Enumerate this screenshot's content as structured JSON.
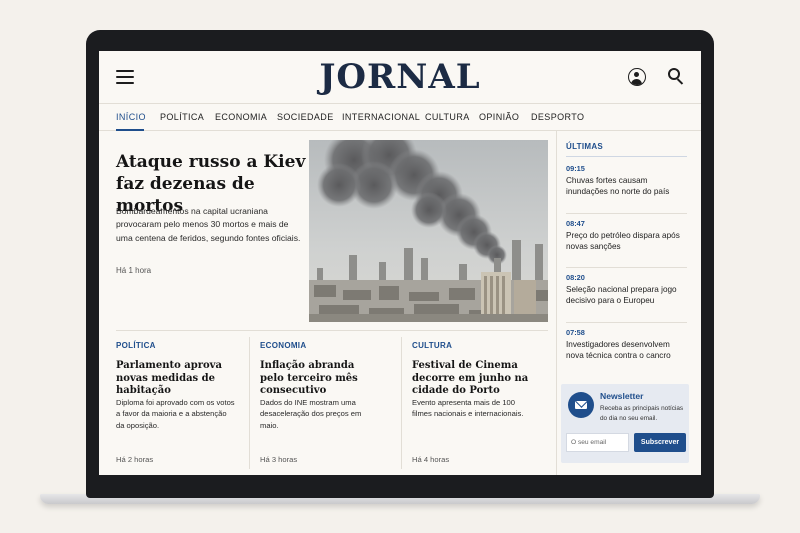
{
  "header": {
    "logo": "JORNAL",
    "menu_icon": "hamburger-icon",
    "account_icon": "user-icon",
    "search_icon": "search-icon"
  },
  "nav": {
    "items": [
      "INÍCIO",
      "POLÍTICA",
      "ECONOMIA",
      "SOCIEDADE",
      "INTERNACIONAL",
      "CULTURA",
      "OPINIÃO",
      "DESPORTO"
    ],
    "active": "INÍCIO"
  },
  "hero": {
    "title": "Ataque russo a Kiev faz dezenas de mortos",
    "summary": "Bombardeamentos na capital ucraniana provocaram pelo menos 30 mortos e mais de uma centena de feridos, segundo fontes oficiais.",
    "time": "Há 1 hora"
  },
  "articles": [
    {
      "category": "POLÍTICA",
      "title": "Parlamento aprova novas medidas de habitação",
      "summary": "Diploma foi aprovado com os votos a favor da maioria e a abstenção da oposição.",
      "time": "Há 2 horas"
    },
    {
      "category": "ECONOMIA",
      "title": "Inflação abranda pelo terceiro mês consecutivo",
      "summary": "Dados do INE mostram uma desaceleração dos preços em maio.",
      "time": "Há 3 horas"
    },
    {
      "category": "CULTURA",
      "title": "Festival de Cinema decorre em junho na cidade do Porto",
      "summary": "Evento apresenta mais de 100 filmes nacionais e internacionais.",
      "time": "Há 4 horas"
    }
  ],
  "latest": {
    "title": "ÚLTIMAS",
    "items": [
      {
        "time": "09:15",
        "text": "Chuvas fortes causam inundações no norte do país"
      },
      {
        "time": "08:47",
        "text": "Preço do petróleo dispara após novas sanções"
      },
      {
        "time": "08:20",
        "text": "Seleção nacional prepara jogo decisivo para o Europeu"
      },
      {
        "time": "07:58",
        "text": "Investigadores desenvolvem nova técnica contra o cancro"
      }
    ]
  },
  "newsletter": {
    "title": "Newsletter",
    "text": "Receba as principais notícias do dia no seu email.",
    "placeholder": "O seu email",
    "button": "Subscrever",
    "icon": "envelope-icon"
  },
  "colors": {
    "accent": "#1f4e8c",
    "logo": "#1c2b44",
    "background": "#faf8f4",
    "newsletter_bg": "#e6eaf1"
  }
}
